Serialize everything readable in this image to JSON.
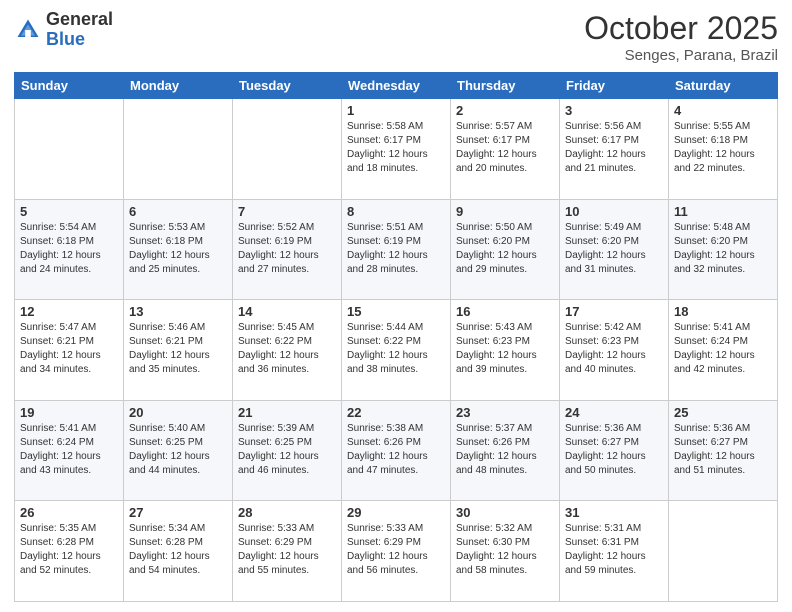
{
  "header": {
    "logo_general": "General",
    "logo_blue": "Blue",
    "month_title": "October 2025",
    "subtitle": "Senges, Parana, Brazil"
  },
  "weekdays": [
    "Sunday",
    "Monday",
    "Tuesday",
    "Wednesday",
    "Thursday",
    "Friday",
    "Saturday"
  ],
  "weeks": [
    [
      {
        "day": "",
        "info": ""
      },
      {
        "day": "",
        "info": ""
      },
      {
        "day": "",
        "info": ""
      },
      {
        "day": "1",
        "info": "Sunrise: 5:58 AM\nSunset: 6:17 PM\nDaylight: 12 hours\nand 18 minutes."
      },
      {
        "day": "2",
        "info": "Sunrise: 5:57 AM\nSunset: 6:17 PM\nDaylight: 12 hours\nand 20 minutes."
      },
      {
        "day": "3",
        "info": "Sunrise: 5:56 AM\nSunset: 6:17 PM\nDaylight: 12 hours\nand 21 minutes."
      },
      {
        "day": "4",
        "info": "Sunrise: 5:55 AM\nSunset: 6:18 PM\nDaylight: 12 hours\nand 22 minutes."
      }
    ],
    [
      {
        "day": "5",
        "info": "Sunrise: 5:54 AM\nSunset: 6:18 PM\nDaylight: 12 hours\nand 24 minutes."
      },
      {
        "day": "6",
        "info": "Sunrise: 5:53 AM\nSunset: 6:18 PM\nDaylight: 12 hours\nand 25 minutes."
      },
      {
        "day": "7",
        "info": "Sunrise: 5:52 AM\nSunset: 6:19 PM\nDaylight: 12 hours\nand 27 minutes."
      },
      {
        "day": "8",
        "info": "Sunrise: 5:51 AM\nSunset: 6:19 PM\nDaylight: 12 hours\nand 28 minutes."
      },
      {
        "day": "9",
        "info": "Sunrise: 5:50 AM\nSunset: 6:20 PM\nDaylight: 12 hours\nand 29 minutes."
      },
      {
        "day": "10",
        "info": "Sunrise: 5:49 AM\nSunset: 6:20 PM\nDaylight: 12 hours\nand 31 minutes."
      },
      {
        "day": "11",
        "info": "Sunrise: 5:48 AM\nSunset: 6:20 PM\nDaylight: 12 hours\nand 32 minutes."
      }
    ],
    [
      {
        "day": "12",
        "info": "Sunrise: 5:47 AM\nSunset: 6:21 PM\nDaylight: 12 hours\nand 34 minutes."
      },
      {
        "day": "13",
        "info": "Sunrise: 5:46 AM\nSunset: 6:21 PM\nDaylight: 12 hours\nand 35 minutes."
      },
      {
        "day": "14",
        "info": "Sunrise: 5:45 AM\nSunset: 6:22 PM\nDaylight: 12 hours\nand 36 minutes."
      },
      {
        "day": "15",
        "info": "Sunrise: 5:44 AM\nSunset: 6:22 PM\nDaylight: 12 hours\nand 38 minutes."
      },
      {
        "day": "16",
        "info": "Sunrise: 5:43 AM\nSunset: 6:23 PM\nDaylight: 12 hours\nand 39 minutes."
      },
      {
        "day": "17",
        "info": "Sunrise: 5:42 AM\nSunset: 6:23 PM\nDaylight: 12 hours\nand 40 minutes."
      },
      {
        "day": "18",
        "info": "Sunrise: 5:41 AM\nSunset: 6:24 PM\nDaylight: 12 hours\nand 42 minutes."
      }
    ],
    [
      {
        "day": "19",
        "info": "Sunrise: 5:41 AM\nSunset: 6:24 PM\nDaylight: 12 hours\nand 43 minutes."
      },
      {
        "day": "20",
        "info": "Sunrise: 5:40 AM\nSunset: 6:25 PM\nDaylight: 12 hours\nand 44 minutes."
      },
      {
        "day": "21",
        "info": "Sunrise: 5:39 AM\nSunset: 6:25 PM\nDaylight: 12 hours\nand 46 minutes."
      },
      {
        "day": "22",
        "info": "Sunrise: 5:38 AM\nSunset: 6:26 PM\nDaylight: 12 hours\nand 47 minutes."
      },
      {
        "day": "23",
        "info": "Sunrise: 5:37 AM\nSunset: 6:26 PM\nDaylight: 12 hours\nand 48 minutes."
      },
      {
        "day": "24",
        "info": "Sunrise: 5:36 AM\nSunset: 6:27 PM\nDaylight: 12 hours\nand 50 minutes."
      },
      {
        "day": "25",
        "info": "Sunrise: 5:36 AM\nSunset: 6:27 PM\nDaylight: 12 hours\nand 51 minutes."
      }
    ],
    [
      {
        "day": "26",
        "info": "Sunrise: 5:35 AM\nSunset: 6:28 PM\nDaylight: 12 hours\nand 52 minutes."
      },
      {
        "day": "27",
        "info": "Sunrise: 5:34 AM\nSunset: 6:28 PM\nDaylight: 12 hours\nand 54 minutes."
      },
      {
        "day": "28",
        "info": "Sunrise: 5:33 AM\nSunset: 6:29 PM\nDaylight: 12 hours\nand 55 minutes."
      },
      {
        "day": "29",
        "info": "Sunrise: 5:33 AM\nSunset: 6:29 PM\nDaylight: 12 hours\nand 56 minutes."
      },
      {
        "day": "30",
        "info": "Sunrise: 5:32 AM\nSunset: 6:30 PM\nDaylight: 12 hours\nand 58 minutes."
      },
      {
        "day": "31",
        "info": "Sunrise: 5:31 AM\nSunset: 6:31 PM\nDaylight: 12 hours\nand 59 minutes."
      },
      {
        "day": "",
        "info": ""
      }
    ]
  ]
}
